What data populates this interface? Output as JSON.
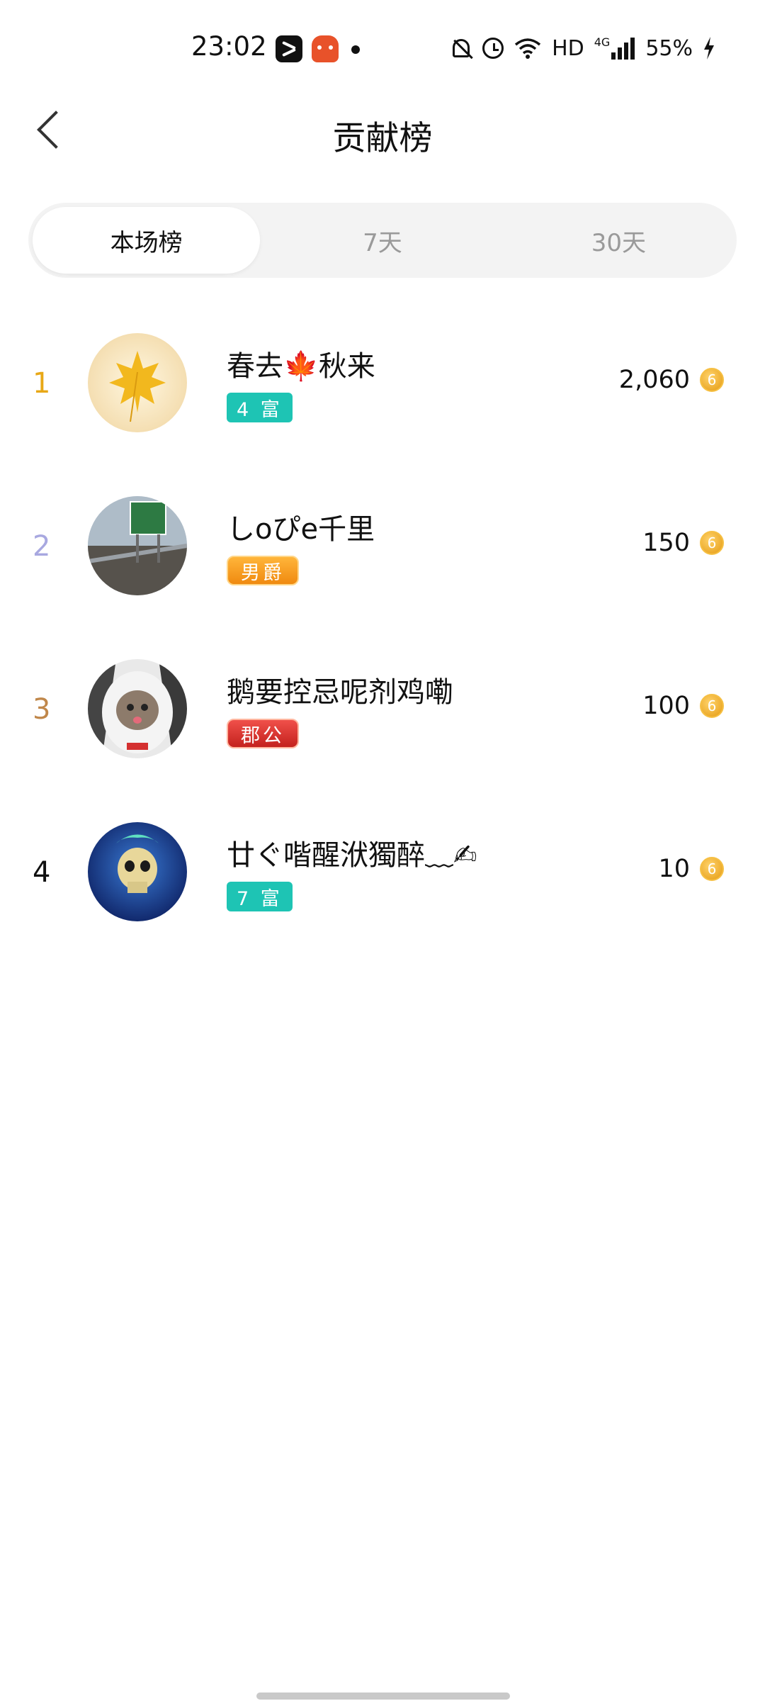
{
  "status_bar": {
    "time": "23:02",
    "network": "HD",
    "signal_label": "4G",
    "battery": "55%",
    "icons": [
      "capcut-app-icon",
      "robot-app-icon",
      "notification-dot",
      "mute-bell-icon",
      "alarm-icon",
      "wifi-icon",
      "signal-icon",
      "charging-bolt-icon"
    ]
  },
  "header": {
    "title": "贡献榜",
    "back_icon": "chevron-left-icon"
  },
  "tabs": [
    {
      "label": "本场榜",
      "active": true
    },
    {
      "label": "7天",
      "active": false
    },
    {
      "label": "30天",
      "active": false
    }
  ],
  "rows": [
    {
      "rank": "1",
      "rank_color": "#e8a817",
      "name": "春去🍁秋来",
      "badge": "4 富",
      "badge_style": "teal",
      "score": "2,060",
      "avatar": "maple-leaf-avatar"
    },
    {
      "rank": "2",
      "rank_color": "#a8a8e0",
      "name": "しoぴe千里",
      "badge": "男爵",
      "badge_style": "orange",
      "score": "150",
      "avatar": "highway-sign-avatar"
    },
    {
      "rank": "3",
      "rank_color": "#c0874a",
      "name": "鹅要控忌呢剂鸡嘞",
      "badge": "郡公",
      "badge_style": "red",
      "score": "100",
      "avatar": "cat-hoodie-avatar"
    },
    {
      "rank": "4",
      "rank_color": "#111111",
      "name": "廿ぐ喈醒洑獨醉﹏✍",
      "badge": "7 富",
      "badge_style": "teal",
      "score": "10",
      "avatar": "skull-avatar"
    }
  ],
  "coin_glyph": "6",
  "colors": {
    "badge_teal": "#1ec4b4",
    "tab_bg": "#f3f3f3",
    "coin": "#e49a12"
  }
}
